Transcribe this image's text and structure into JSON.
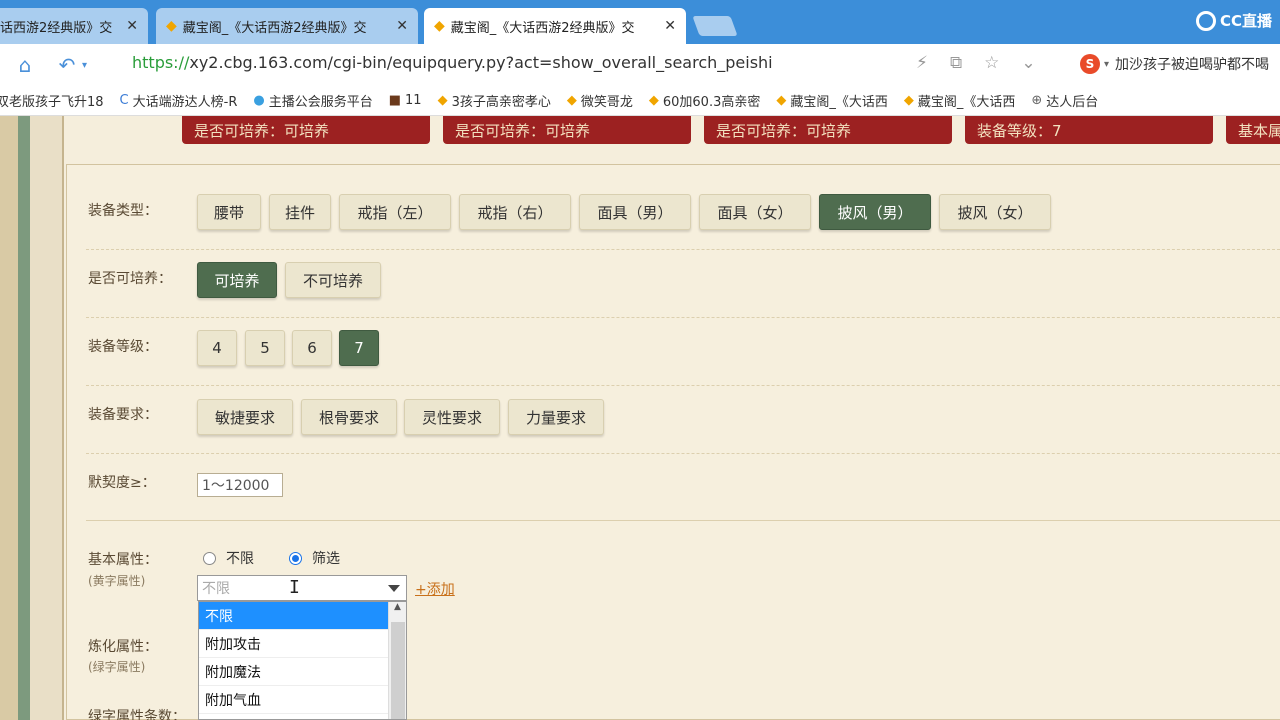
{
  "tabs": [
    {
      "title": "话西游2经典版》交",
      "active": false
    },
    {
      "title": "藏宝阁_《大话西游2经典版》交",
      "active": false
    },
    {
      "title": "藏宝阁_《大话西游2经典版》交",
      "active": true
    }
  ],
  "brand": "CC直播",
  "address": {
    "scheme": "https://",
    "rest": "xy2.cbg.163.com/cgi-bin/equipquery.py?act=show_overall_search_peishi"
  },
  "news": "加沙孩子被迫喝驴都不喝",
  "bookmarks": [
    "双老版孩子飞升18",
    "大话端游达人榜-R",
    "主播公会服务平台",
    "11",
    "3孩子高亲密孝心",
    "微笑哥龙",
    "60加60.3高亲密",
    "藏宝阁_《大话西",
    "藏宝阁_《大话西",
    "达人后台"
  ],
  "cards": [
    "是否可培养：可培养",
    "是否可培养：可培养",
    "是否可培养：可培养",
    "装备等级：7",
    "基本属"
  ],
  "filters": {
    "type_label": "装备类型：",
    "type_options": [
      "腰带",
      "挂件",
      "戒指（左）",
      "戒指（右）",
      "面具（男）",
      "面具（女）",
      "披风（男）",
      "披风（女）"
    ],
    "type_selected": "披风（男）",
    "train_label": "是否可培养：",
    "train_options": [
      "可培养",
      "不可培养"
    ],
    "level_label": "装备等级：",
    "level_options": [
      "4",
      "5",
      "6",
      "7"
    ],
    "req_label": "装备要求：",
    "req_options": [
      "敏捷要求",
      "根骨要求",
      "灵性要求",
      "力量要求"
    ],
    "tacit_label": "默契度≥：",
    "tacit_value": "1～12000",
    "base_label": "基本属性：",
    "base_sub": "(黄字属性)",
    "radio_none": "不限",
    "radio_filter": "筛选",
    "select_value": "不限",
    "add_link": "+添加",
    "refine_label": "炼化属性：",
    "refine_sub": "(绿字属性)",
    "green_label": "绿字属性条数：",
    "dropdown_items": [
      "不限",
      "附加攻击",
      "附加魔法",
      "附加气血"
    ]
  }
}
